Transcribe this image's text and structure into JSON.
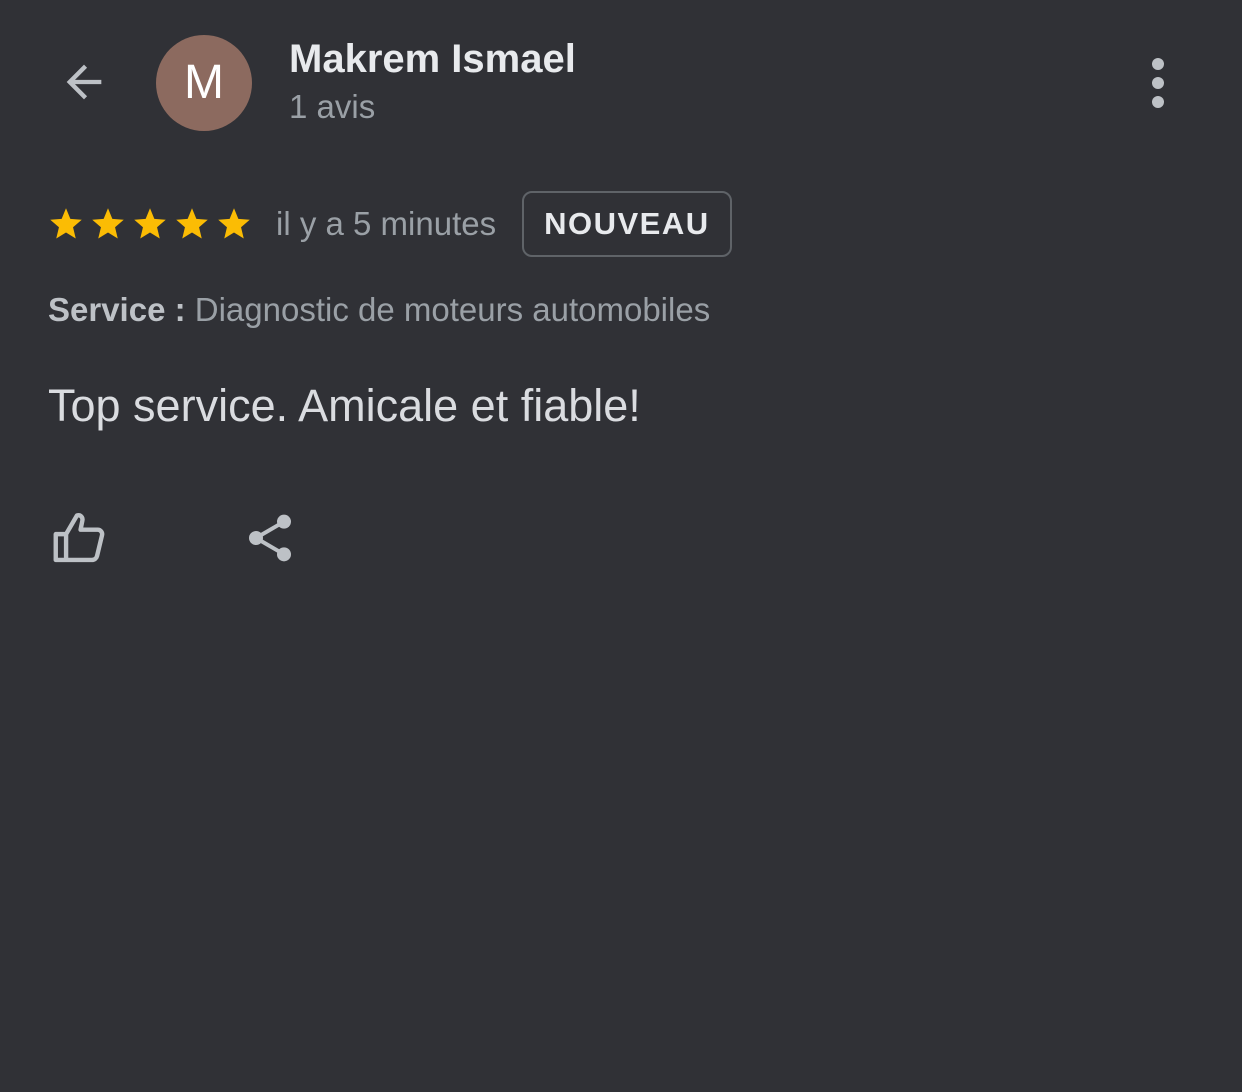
{
  "header": {
    "back_icon": "arrow-left-icon",
    "avatar": {
      "initial": "M",
      "color": "#8c6a5f"
    },
    "reviewer_name": "Makrem Ismael",
    "review_count": "1 avis",
    "more_icon": "more-vert-icon"
  },
  "review": {
    "rating": 5,
    "rating_max": 5,
    "star_color": "#fbbc04",
    "time_ago": "il y a 5 minutes",
    "badge": "NOUVEAU",
    "service_label": "Service :",
    "service_value": "Diagnostic de moteurs automobiles",
    "text": "Top service. Amicale et fiable!"
  },
  "actions": {
    "like_icon": "thumb-up-icon",
    "share_icon": "share-icon"
  },
  "colors": {
    "background": "#303136",
    "icon": "#bdc1c6"
  }
}
